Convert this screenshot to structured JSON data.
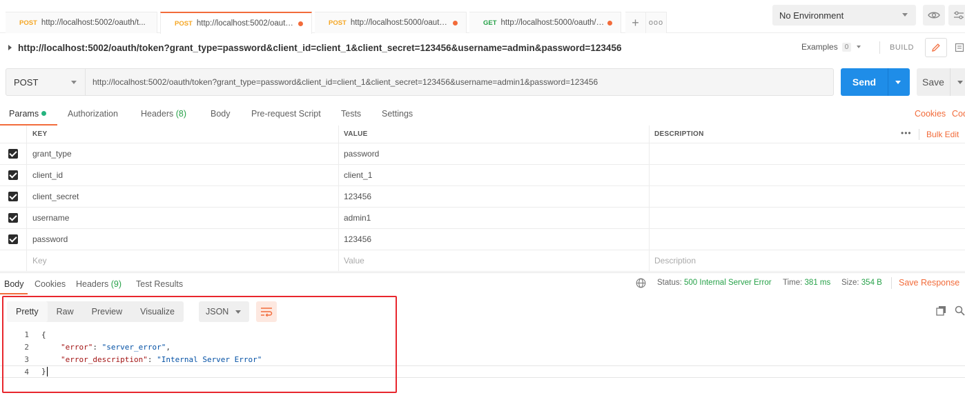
{
  "tabs": [
    {
      "method": "POST",
      "url": "http://localhost:5002/oauth/t...",
      "modified": false,
      "active": false
    },
    {
      "method": "POST",
      "url": "http://localhost:5002/oauth/to...",
      "modified": true,
      "active": true
    },
    {
      "method": "POST",
      "url": "http://localhost:5000/oauth/to...",
      "modified": true,
      "active": false
    },
    {
      "method": "GET",
      "url": "http://localhost:5000/oauth/tok...",
      "modified": true,
      "active": false
    }
  ],
  "tab_add_label": "+",
  "tab_more_label": "ooo",
  "environment": {
    "selected": "No Environment"
  },
  "request": {
    "title": "http://localhost:5002/oauth/token?grant_type=password&client_id=client_1&client_secret=123456&username=admin&password=123456",
    "examples_label": "Examples",
    "examples_count": "0",
    "build_label": "BUILD",
    "method": "POST",
    "url": "http://localhost:5002/oauth/token?grant_type=password&client_id=client_1&client_secret=123456&username=admin1&password=123456",
    "send_label": "Send",
    "save_label": "Save"
  },
  "request_tabs": {
    "params": "Params",
    "authorization": "Authorization",
    "headers": "Headers",
    "headers_count": "(8)",
    "body": "Body",
    "prerequest": "Pre-request Script",
    "tests": "Tests",
    "settings": "Settings",
    "cookies": "Cookies",
    "code": "Code"
  },
  "params_table": {
    "columns": {
      "key": "KEY",
      "value": "VALUE",
      "description": "DESCRIPTION"
    },
    "more": "•••",
    "bulk_edit": "Bulk Edit",
    "rows": [
      {
        "key": "grant_type",
        "value": "password",
        "description": ""
      },
      {
        "key": "client_id",
        "value": "client_1",
        "description": ""
      },
      {
        "key": "client_secret",
        "value": "123456",
        "description": ""
      },
      {
        "key": "username",
        "value": "admin1",
        "description": ""
      },
      {
        "key": "password",
        "value": "123456",
        "description": ""
      }
    ],
    "placeholders": {
      "key": "Key",
      "value": "Value",
      "description": "Description"
    }
  },
  "response_tabs": {
    "body": "Body",
    "cookies": "Cookies",
    "headers": "Headers",
    "headers_count": "(9)",
    "test_results": "Test Results"
  },
  "response_status": {
    "status_label": "Status:",
    "status_value": "500 Internal Server Error",
    "time_label": "Time:",
    "time_value": "381 ms",
    "size_label": "Size:",
    "size_value": "354 B",
    "save_response": "Save Response"
  },
  "body_view": {
    "formats": [
      "Pretty",
      "Raw",
      "Preview",
      "Visualize"
    ],
    "active_format": "Pretty",
    "language": "JSON"
  },
  "code_lines": [
    {
      "n": "1",
      "open": "{"
    },
    {
      "n": "2",
      "key": "\"error\"",
      "sep": ": ",
      "val": "\"server_error\"",
      "end": ","
    },
    {
      "n": "3",
      "key": "\"error_description\"",
      "sep": ": ",
      "val": "\"Internal Server Error\"",
      "end": ""
    },
    {
      "n": "4",
      "close": "}"
    }
  ],
  "colors": {
    "accent": "#f26b3a",
    "send": "#1f8de8",
    "success": "#26a148",
    "highlight": "#e8262d"
  }
}
